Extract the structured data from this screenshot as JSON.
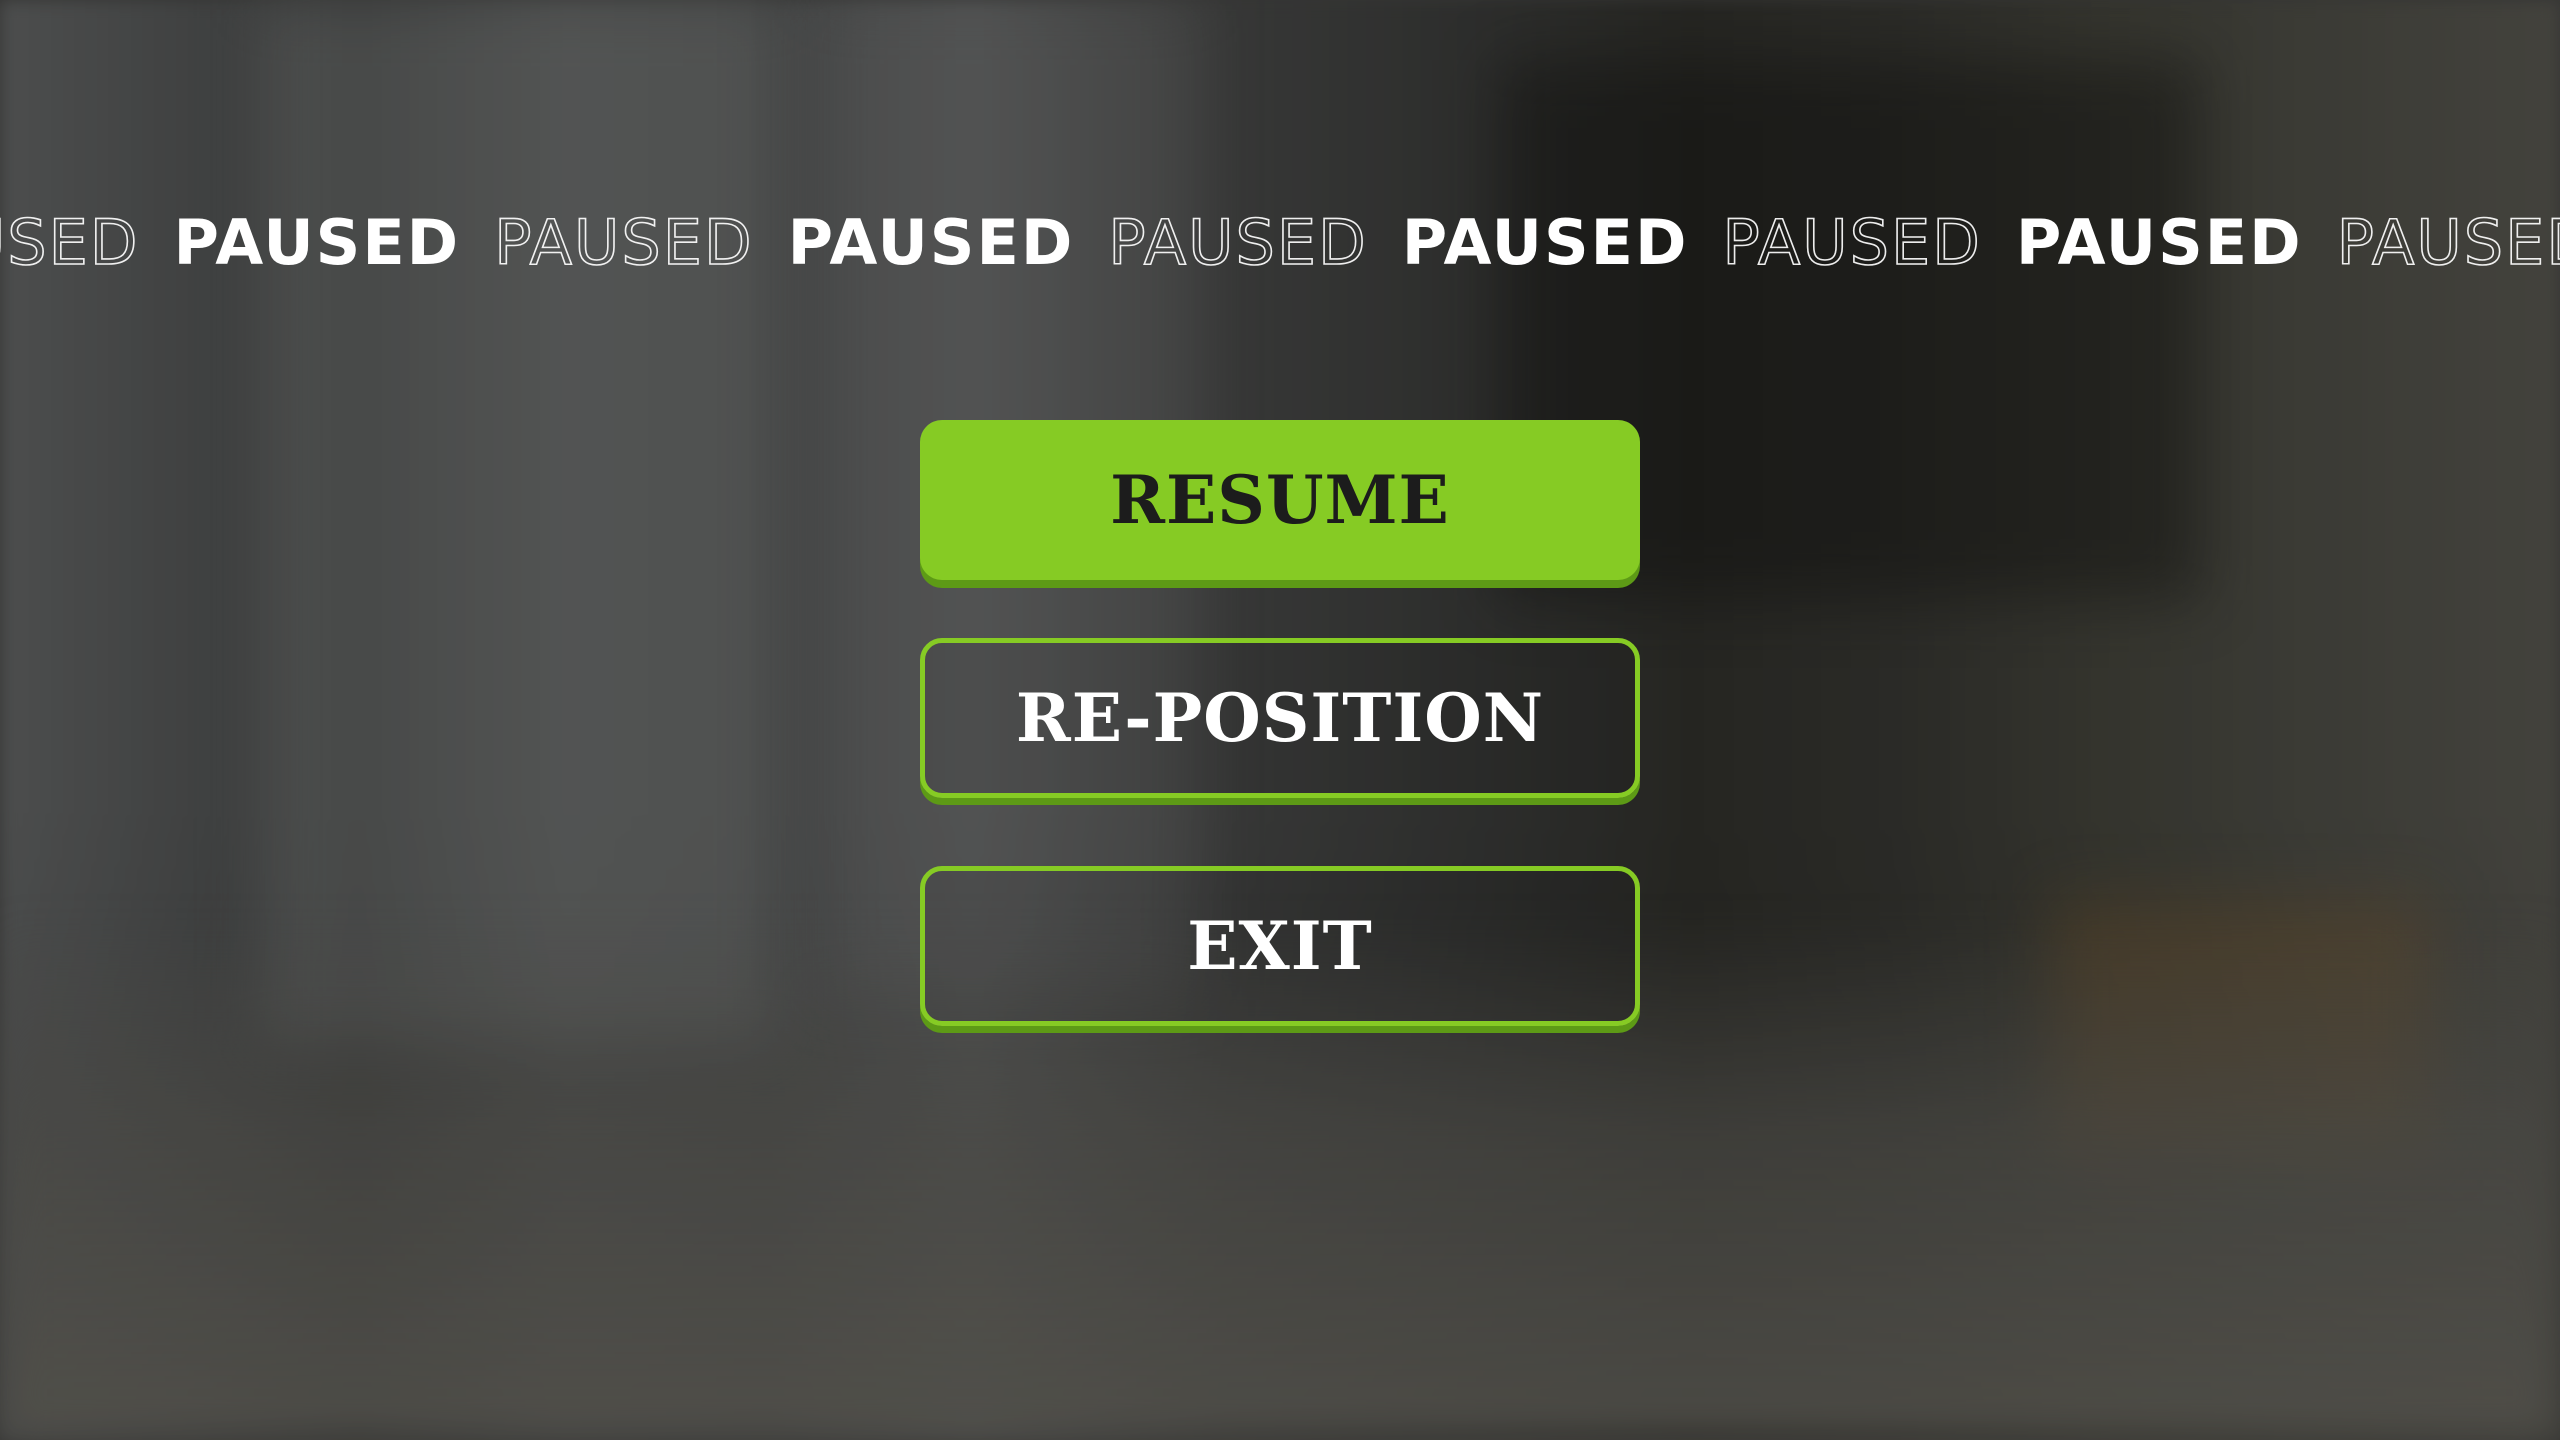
{
  "banner": {
    "items": [
      {
        "text": "PAUSED",
        "style": "thin"
      },
      {
        "text": "PAUSED",
        "style": "bold"
      },
      {
        "text": "PAUSED",
        "style": "thin"
      },
      {
        "text": "PAUSED",
        "style": "bold"
      },
      {
        "text": "PAUSED",
        "style": "thin"
      },
      {
        "text": "PAUSED",
        "style": "bold"
      },
      {
        "text": "PAUSED",
        "style": "thin"
      },
      {
        "text": "PAUSED",
        "style": "bold"
      },
      {
        "text": "PAUSED",
        "style": "thin"
      },
      {
        "text": "PAUSED",
        "style": "bold"
      }
    ]
  },
  "menu": {
    "resume_label": "RESUME",
    "reposition_label": "RE-POSITION",
    "exit_label": "EXIT"
  },
  "colors": {
    "accent": "#86cb24",
    "accent_shadow": "#5d9a16",
    "text_dark": "#1c1c1c",
    "text_light": "#ffffff"
  }
}
